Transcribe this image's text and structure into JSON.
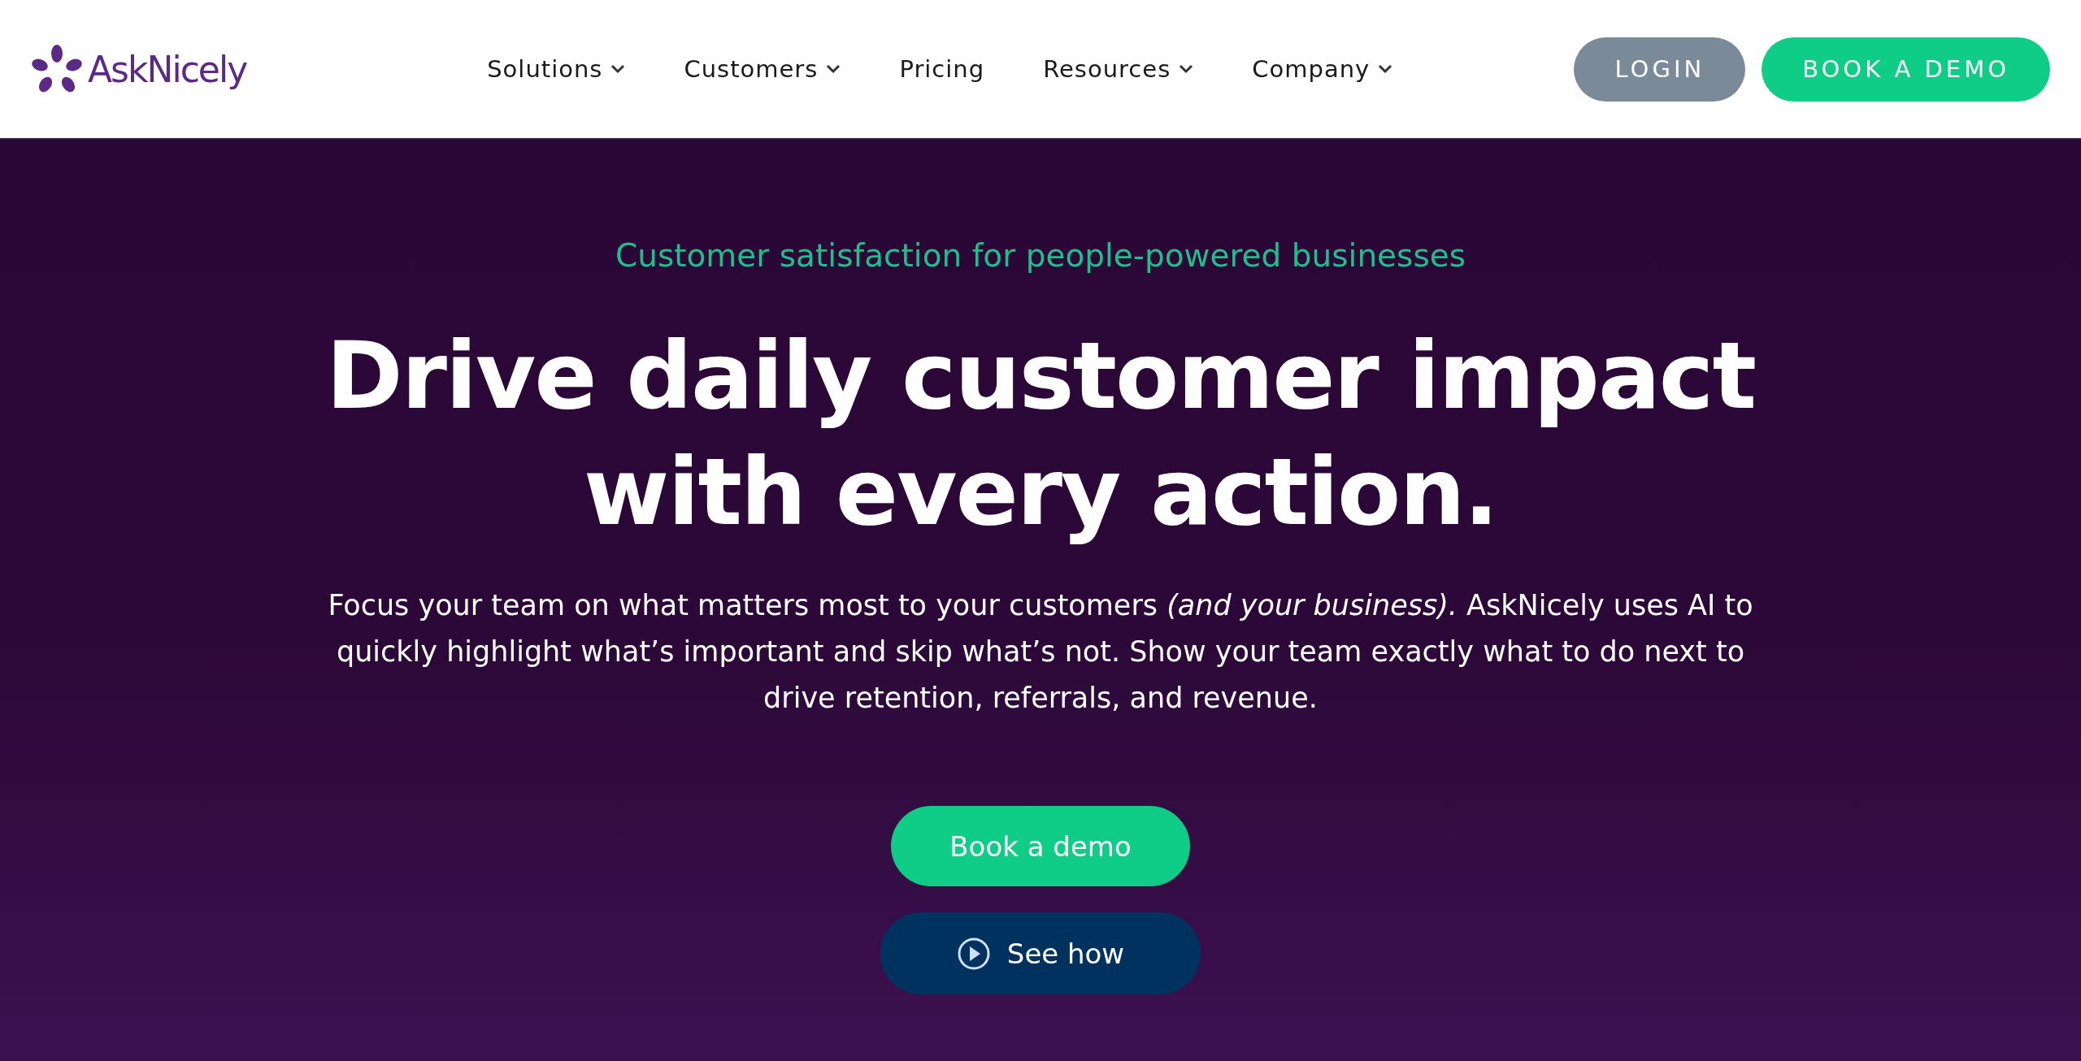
{
  "header": {
    "logo": "AskNicely",
    "nav": [
      {
        "label": "Solutions",
        "has_menu": true
      },
      {
        "label": "Customers",
        "has_menu": true
      },
      {
        "label": "Pricing",
        "has_menu": false
      },
      {
        "label": "Resources",
        "has_menu": true
      },
      {
        "label": "Company",
        "has_menu": true
      }
    ],
    "buttons": [
      {
        "label": "LOGIN",
        "kind": "secondary"
      },
      {
        "label": "BOOK A DEMO",
        "kind": "primary"
      }
    ]
  },
  "hero": {
    "eyebrow": "Customer satisfaction for people-powered businesses",
    "headline": "Drive daily customer impact with every action.",
    "body": "Focus your team on what matters most to your customers *(and your business).* AskNicely uses AI to quickly highlight what’s important and skip what’s not. Show your team exactly what to do next to drive retention, referrals, and revenue.",
    "buttons": [
      {
        "label": "Book a demo",
        "kind": "primary"
      },
      {
        "label": "See how",
        "kind": "video"
      }
    ]
  }
}
